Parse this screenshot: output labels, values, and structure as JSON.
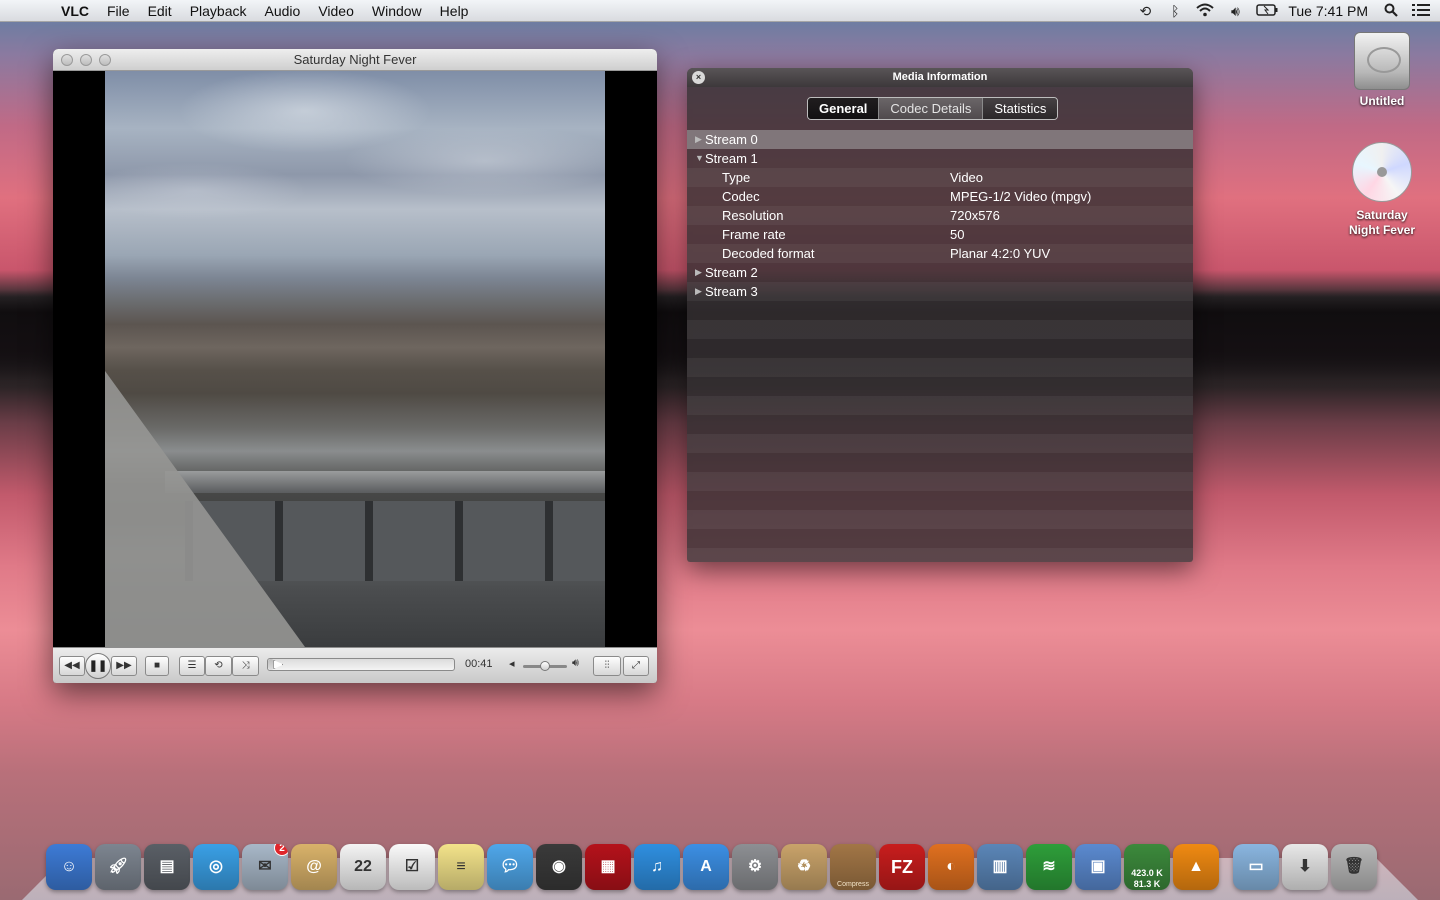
{
  "menubar": {
    "app": "VLC",
    "items": [
      "File",
      "Edit",
      "Playback",
      "Audio",
      "Video",
      "Window",
      "Help"
    ],
    "clock": "Tue 7:41 PM",
    "icons": [
      "time-machine-icon",
      "bluetooth-icon",
      "wifi-icon",
      "volume-icon",
      "battery-icon",
      "spotlight-icon",
      "notification-list-icon"
    ]
  },
  "player": {
    "title": "Saturday Night Fever",
    "time": "00:41",
    "progress": 0.02,
    "volume": 0.5
  },
  "media_info": {
    "title": "Media Information",
    "tabs": [
      "General",
      "Codec Details",
      "Statistics"
    ],
    "streams": [
      {
        "label": "Stream 0",
        "expanded": false
      },
      {
        "label": "Stream 1",
        "expanded": true,
        "fields": [
          {
            "key": "Type",
            "value": "Video"
          },
          {
            "key": "Codec",
            "value": "MPEG-1/2 Video (mpgv)"
          },
          {
            "key": "Resolution",
            "value": "720x576"
          },
          {
            "key": "Frame rate",
            "value": "50"
          },
          {
            "key": "Decoded format",
            "value": "Planar 4:2:0 YUV"
          }
        ]
      },
      {
        "label": "Stream 2",
        "expanded": false
      },
      {
        "label": "Stream 3",
        "expanded": false
      }
    ]
  },
  "desktop": {
    "icons": [
      {
        "label": "Untitled",
        "kind": "hard-drive-icon"
      },
      {
        "label": "Saturday Night Fever",
        "kind": "dvd-icon"
      }
    ]
  },
  "dock": {
    "mail_badge": "2",
    "network_up": "423.0 K",
    "network_down": "81.3 K",
    "compress_label": "Compress",
    "items": [
      {
        "name": "finder-icon",
        "color": "#3d7bd6"
      },
      {
        "name": "launchpad-icon",
        "color": "#7d8590"
      },
      {
        "name": "photo-browser-icon",
        "color": "#5a5f66"
      },
      {
        "name": "safari-icon",
        "color": "#3aa0e6"
      },
      {
        "name": "mail-icon",
        "color": "#a8b8c8"
      },
      {
        "name": "contacts-icon",
        "color": "#d9b26a"
      },
      {
        "name": "calendar-icon",
        "color": "#f4f4f4"
      },
      {
        "name": "reminders-icon",
        "color": "#fafafa"
      },
      {
        "name": "notes-icon",
        "color": "#f3e38a"
      },
      {
        "name": "messages-icon",
        "color": "#4fa7ea"
      },
      {
        "name": "facetime-icon",
        "color": "#3a3a3a"
      },
      {
        "name": "photo-booth-icon",
        "color": "#b5121b"
      },
      {
        "name": "itunes-icon",
        "color": "#2f8fe0"
      },
      {
        "name": "app-store-icon",
        "color": "#3c8fe4"
      },
      {
        "name": "system-preferences-icon",
        "color": "#8d8f93"
      },
      {
        "name": "recycle-icon",
        "color": "#c9a36a"
      },
      {
        "name": "archive-icon",
        "color": "#a27646"
      },
      {
        "name": "filezilla-icon",
        "color": "#c81d1d"
      },
      {
        "name": "firefox-icon",
        "color": "#e0701f"
      },
      {
        "name": "activity-monitor-icon",
        "color": "#5b86b8"
      },
      {
        "name": "spotify-icon",
        "color": "#2e9e3a"
      },
      {
        "name": "preview-icon",
        "color": "#5b8ad0"
      },
      {
        "name": "network-monitor-icon",
        "color": "#3c8a3c"
      },
      {
        "name": "vlc-icon",
        "color": "#f08a12"
      },
      {
        "name": "applications-folder-icon",
        "color": "#8ab6e0"
      },
      {
        "name": "downloads-icon",
        "color": "#e8e8e8"
      },
      {
        "name": "trash-icon",
        "color": "#b8b8b8"
      }
    ]
  }
}
